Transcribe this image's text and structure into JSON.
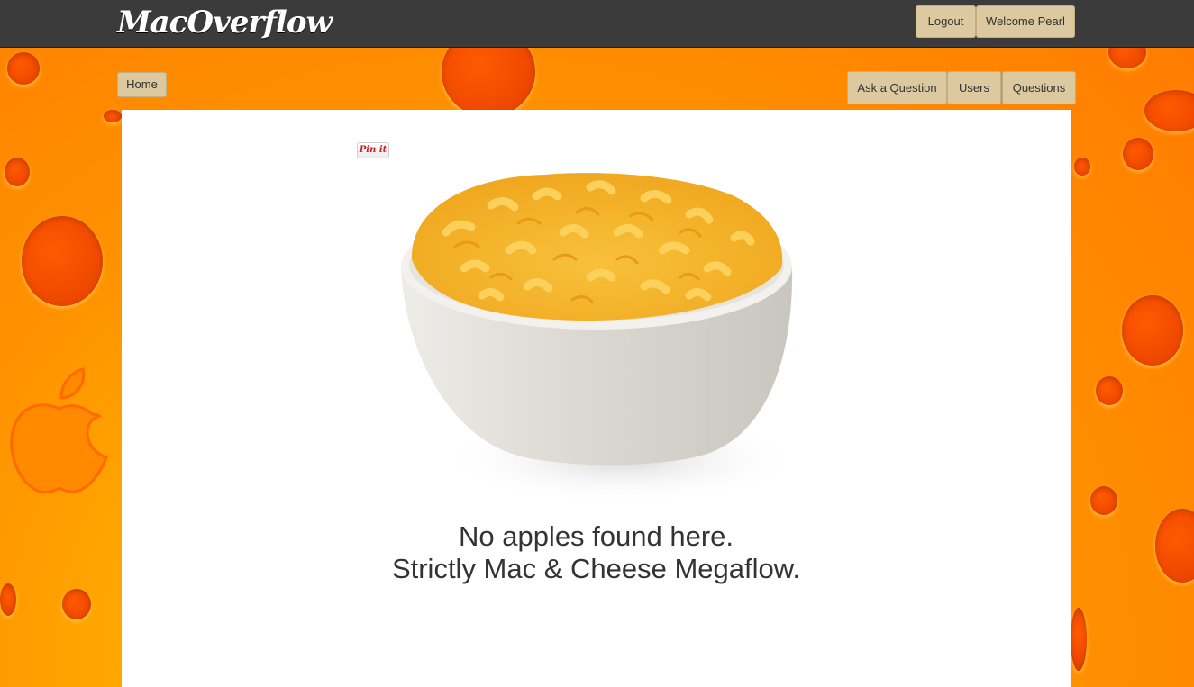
{
  "header": {
    "brand": "MacOverflow",
    "logout_label": "Logout",
    "welcome_label": "Welcome Pearl"
  },
  "nav": {
    "home_label": "Home",
    "ask_label": "Ask a Question",
    "users_label": "Users",
    "questions_label": "Questions"
  },
  "main": {
    "pin_label": "Pin it",
    "message_line1": "No apples found here.",
    "message_line2": "Strictly Mac & Cheese Megaflow."
  },
  "colors": {
    "topbar": "#3b3b3b",
    "button": "#dcc9a0",
    "background_orange": "#ff8a00",
    "hole_orange": "#f04a00"
  },
  "icons": {
    "background_logo": "apple-icon",
    "image": "mac-and-cheese-bowl"
  }
}
